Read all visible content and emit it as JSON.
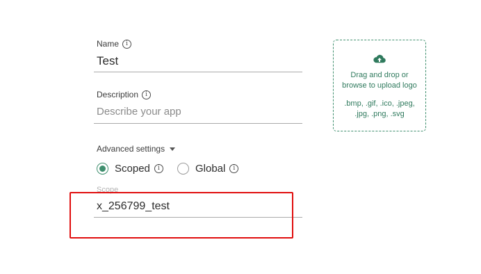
{
  "form": {
    "name": {
      "label": "Name",
      "value": "Test"
    },
    "description": {
      "label": "Description",
      "placeholder": "Describe your app"
    },
    "advanced_settings": {
      "label": "Advanced settings"
    },
    "scope_options": [
      {
        "label": "Scoped",
        "selected": true
      },
      {
        "label": "Global",
        "selected": false
      }
    ],
    "scope": {
      "label": "Scope",
      "value": "x_256799_test"
    }
  },
  "upload": {
    "icon": "cloud-upload-icon",
    "text": "Drag and drop or browse to upload logo",
    "formats": ".bmp, .gif, .ico, .jpeg, .jpg, .png, .svg"
  },
  "colors": {
    "accent": "#3f8f6e",
    "highlight": "#e00d0d"
  }
}
